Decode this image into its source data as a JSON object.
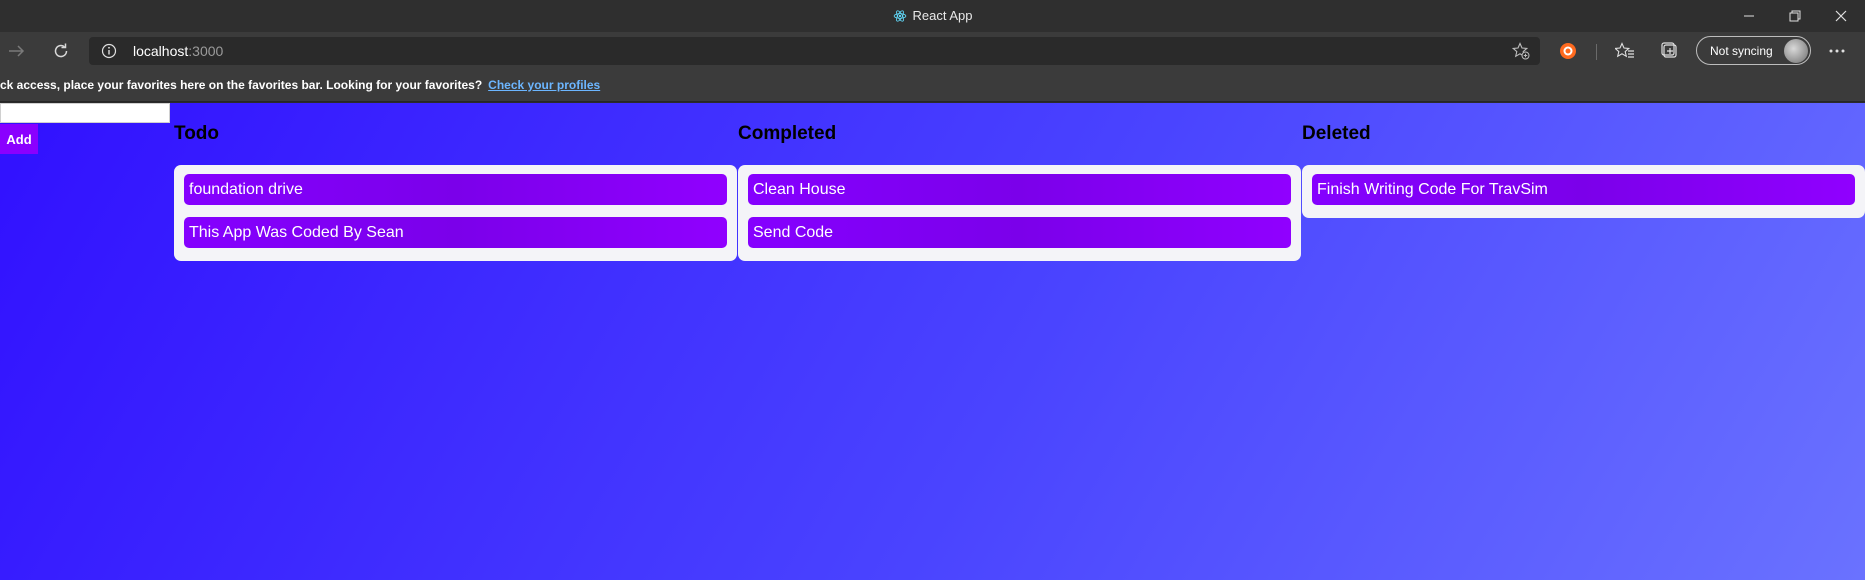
{
  "window": {
    "title": "React App"
  },
  "address_bar": {
    "url_host": "localhost",
    "url_port": ":3000"
  },
  "profile": {
    "sync_label": "Not syncing"
  },
  "favorites_bar": {
    "message": "ck access, place your favorites here on the favorites bar. Looking for your favorites?",
    "link": "Check your profiles"
  },
  "app": {
    "add_label": "Add",
    "input_value": "",
    "columns": [
      {
        "title": "Todo",
        "items": [
          "foundation drive",
          "This App Was Coded By Sean"
        ]
      },
      {
        "title": "Completed",
        "items": [
          "Clean House",
          "Send Code"
        ]
      },
      {
        "title": "Deleted",
        "items": [
          "Finish Writing Code For TravSim"
        ]
      }
    ]
  },
  "colors": {
    "item_purple": "#8500ff",
    "background_start": "#3110ff",
    "background_end": "#6a72ff",
    "card_bg": "#f4f4f8"
  },
  "icons": [
    "react-icon",
    "forward-arrow-icon",
    "refresh-icon",
    "info-icon",
    "add-favorite-icon",
    "extension-icon",
    "favorites-icon",
    "collections-icon",
    "more-icon",
    "minimize-icon",
    "restore-icon",
    "close-icon"
  ]
}
